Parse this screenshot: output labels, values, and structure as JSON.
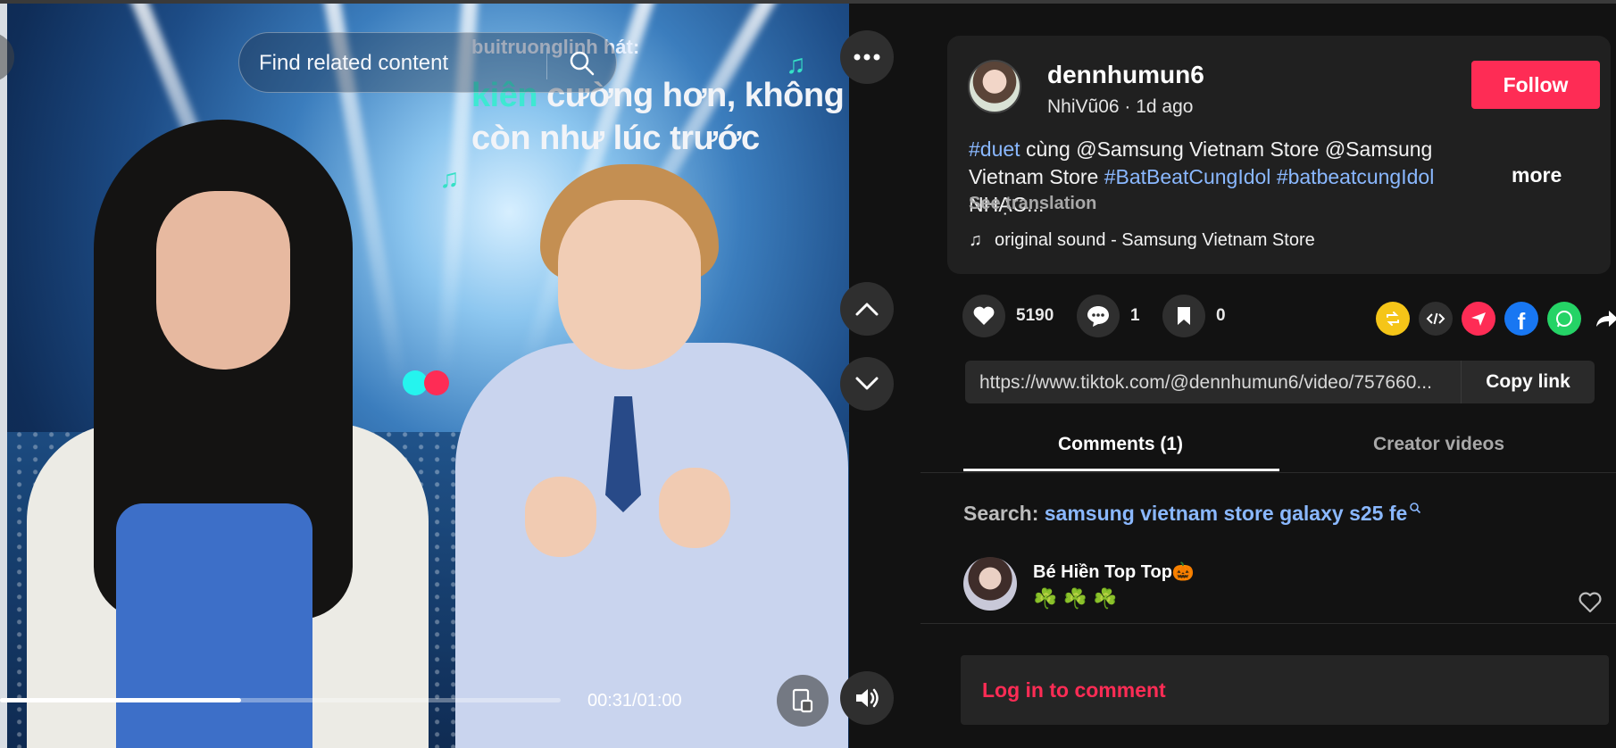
{
  "video": {
    "search_placeholder": "Find related content",
    "lyrics_user": "buitruonglinh hát:",
    "lyrics_line1_accent": "kiên",
    "lyrics_line1_rest": " cường hơn, không",
    "lyrics_line2": "còn như lúc trước",
    "time": "00:31/01:00",
    "progress": 0.43,
    "colors": {
      "accent_teal": "#3ee8d2",
      "loader_cyan": "#25f4ee",
      "loader_red": "#fe2c55"
    }
  },
  "post": {
    "username": "dennhumun6",
    "nickname": "NhiVũ06",
    "age": "1d ago",
    "meta_sep": " · ",
    "follow_label": "Follow",
    "desc": {
      "tag1": "#duet",
      "text1": " cùng @Samsung Vietnam Store @Samsung Vietnam Store ",
      "tag2": "#BatBeatCungIdol",
      "space": " ",
      "tag3": "#batbeatcungIdol",
      "text2": " NHẠC..."
    },
    "more_label": "more",
    "see_translation": "See translation",
    "sound": "original sound - Samsung Vietnam Store"
  },
  "actions": {
    "likes": "5190",
    "comments": "1",
    "saves": "0",
    "share_icons": [
      "repost-icon",
      "embed-icon",
      "send-icon",
      "facebook-icon",
      "whatsapp-icon",
      "share-arrow-icon"
    ]
  },
  "link": {
    "url": "https://www.tiktok.com/@dennhumun6/video/757660...",
    "copy_label": "Copy link"
  },
  "tabs": {
    "comments": "Comments (1)",
    "creator": "Creator videos"
  },
  "search": {
    "label": "Search: ",
    "query": "samsung vietnam store galaxy s25 fe"
  },
  "comment": {
    "name": "Bé Hiền Top Top🎃",
    "text": "☘️ ☘️ ☘️"
  },
  "login": {
    "label": "Log in to comment"
  },
  "colors": {
    "brand_red": "#fe2c55",
    "link_blue": "#8ab8ff",
    "panel_bg": "#121212"
  }
}
